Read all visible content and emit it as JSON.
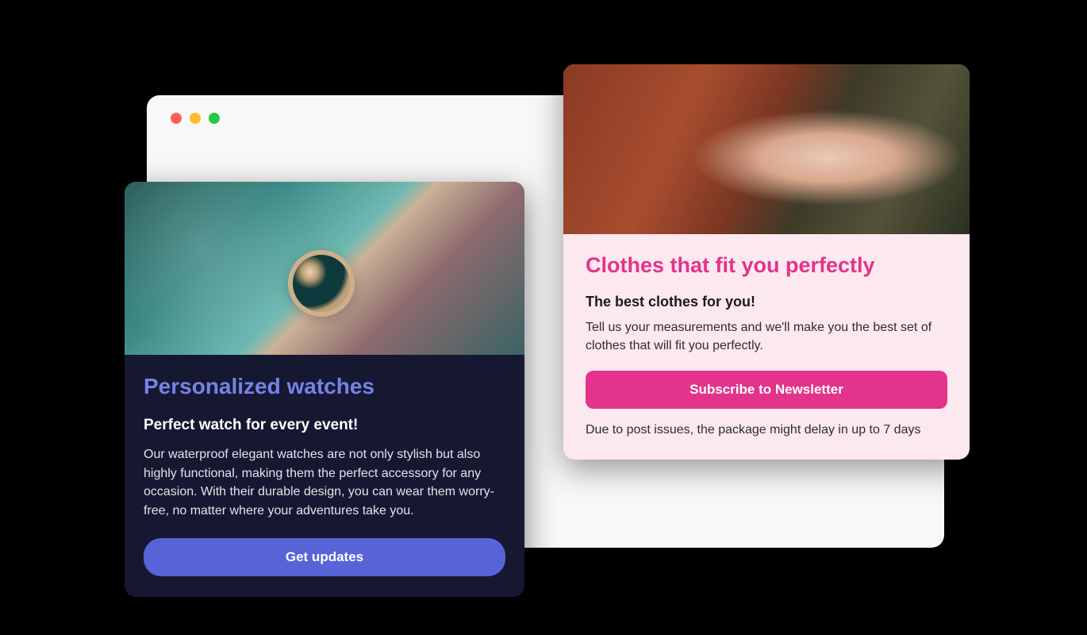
{
  "window": {
    "dots": [
      "red",
      "yellow",
      "green"
    ]
  },
  "card_left": {
    "title": "Personalized watches",
    "subtitle": "Perfect watch for every event!",
    "body": "Our waterproof elegant watches are not only stylish but also highly functional, making them the perfect accessory for any occasion. With their durable design, you can wear them worry-free, no matter where your adventures take you.",
    "cta_label": "Get updates",
    "colors": {
      "accent": "#5863d8",
      "title": "#7682e8",
      "bg": "#161831"
    }
  },
  "card_right": {
    "title": "Clothes that fit you perfectly",
    "subtitle": "The best clothes for you!",
    "body": "Tell us your measurements and we'll make you the best set of clothes that will fit you perfectly.",
    "cta_label": "Subscribe to Newsletter",
    "note": "Due to post issues, the package might delay in up to 7 days",
    "colors": {
      "accent": "#e3338b",
      "bg": "#fce8ef"
    }
  }
}
